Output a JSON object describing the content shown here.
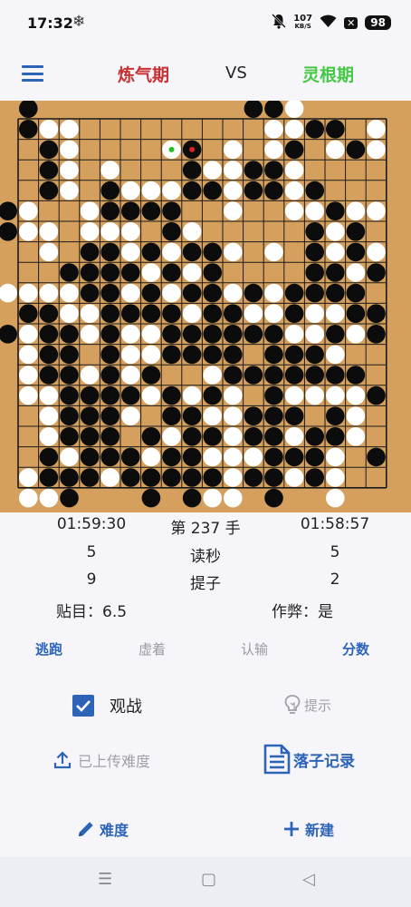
{
  "status_bar": {
    "time": "17:32",
    "speed_value": "107",
    "speed_unit": "KB/S",
    "battery": "98",
    "icons": [
      "snowflake-icon",
      "mute-bell-icon",
      "wifi-icon",
      "x-icon",
      "battery-icon"
    ]
  },
  "header": {
    "menu_icon": "hamburger-menu-icon",
    "black_player": "炼气期",
    "vs": "VS",
    "white_player": "灵根期",
    "colors": {
      "black_player": "#c83232",
      "white_player": "#46c846",
      "accent": "#2e64b8"
    }
  },
  "board": {
    "size": 19,
    "board_color": "#d5a05e",
    "last_move_marker": "red-dot",
    "previous_move_marker": "green-dot",
    "rows": [
      ".X..........XXO....",
      ".XOO.........OOXX.O",
      "..XO....WR.O.OX.OXO",
      "..XO.O...XOOXXO....",
      "..XO.XOOOXXOXXOX...",
      "XO..OXXXX..O..OOXOO",
      "XOO.OOO.XO.....XOX.",
      "..O.XXOXOXXO.O.XOXO",
      "...XXXXOXOX....XXOX",
      "OOOOXXOXOXXOXOXXXX.",
      ".XXOOXXXXOXXOOXOOXX",
      "XOXXOXOOXXXXXXOOXOX",
      ".OXX.XOOXXXX.XXXO..",
      ".OXXOXOX..OXXXXXXX.",
      ".OOXXXXOXOXO.XOOOOX",
      "..OXXXO.XXOOXXX.XO.",
      "..OXXX.XOXXOXXOXXO.",
      "..XOXXXOXXOOOXXXO.X",
      ".OXXXOXXXXXOXXOXO..",
      ".OOX...X.XOO.X..O.."
    ]
  },
  "stats": {
    "black_time": "01:59:30",
    "move_label": "第 237 手",
    "white_time": "01:58:57",
    "black_byoyomi": "5",
    "byoyomi_label": "读秒",
    "white_byoyomi": "5",
    "black_captures": "9",
    "captures_label": "提子",
    "white_captures": "2",
    "komi": "贴目：6.5",
    "cheat": "作弊：是"
  },
  "actions": {
    "escape": "逃跑",
    "pass": "虚着",
    "resign": "认输",
    "score": "分数"
  },
  "controls": {
    "spectate_label": "观战",
    "spectate_checked": true,
    "hint_label": "提示",
    "upload_label": "已上传难度",
    "record_label": "落子记录",
    "difficulty_label": "难度",
    "new_game_label": "新建"
  },
  "nav_bar": {
    "icons": [
      "recents-icon",
      "home-icon",
      "back-icon"
    ]
  }
}
